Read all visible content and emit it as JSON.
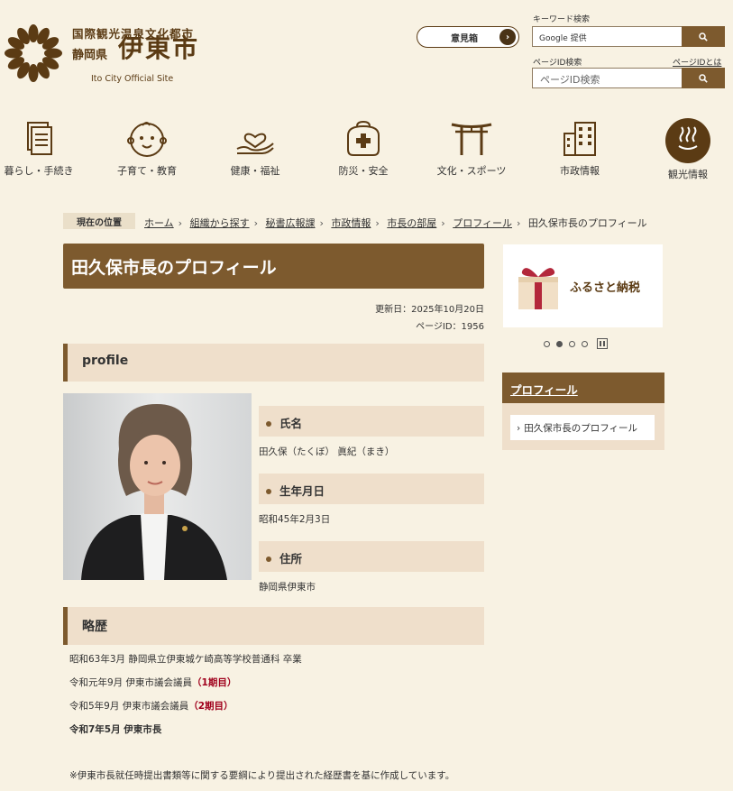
{
  "header": {
    "logo_line1": "国際観光温泉文化都市",
    "logo_prefecture": "静岡県",
    "logo_city": "伊東市",
    "logo_en": "Ito City Official Site",
    "voice_box_label": "意見箱",
    "keyword_label": "キーワード検索",
    "keyword_placeholder": "Google 提供",
    "pageid_label": "ページID検索",
    "pageid_help": "ページIDとは",
    "pageid_placeholder": "ページID検索"
  },
  "nav": [
    {
      "label": "暮らし・手続き",
      "icon": "document-icon"
    },
    {
      "label": "子育て・教育",
      "icon": "baby-face-icon"
    },
    {
      "label": "健康・福祉",
      "icon": "heart-hand-icon"
    },
    {
      "label": "防災・安全",
      "icon": "emergency-bag-icon"
    },
    {
      "label": "文化・スポーツ",
      "icon": "torii-icon"
    },
    {
      "label": "市政情報",
      "icon": "building-icon"
    },
    {
      "label": "観光情報",
      "icon": "hot-spring-icon"
    }
  ],
  "breadcrumb": {
    "here_label": "現在の位置",
    "items": [
      "ホーム",
      "組織から探す",
      "秘書広報課",
      "市政情報",
      "市長の部屋",
      "プロフィール"
    ],
    "current": "田久保市長のプロフィール"
  },
  "page": {
    "title": "田久保市長のプロフィール",
    "updated": "更新日：2025年10月20日",
    "page_id": "ページID：1956",
    "section_profile": "profile",
    "fields": [
      {
        "label": "氏名",
        "value": "田久保（たくぼ）  眞紀（まき）"
      },
      {
        "label": "生年月日",
        "value": "昭和45年2月3日"
      },
      {
        "label": "住所",
        "value": "静岡県伊東市"
      }
    ],
    "section_career": "略歴",
    "career": [
      {
        "text": "昭和63年3月 静岡県立伊東城ケ崎高等学校普通科 卒業",
        "note": ""
      },
      {
        "text": "令和元年9月 伊東市議会議員",
        "note": "（1期目）"
      },
      {
        "text": "令和5年9月 伊東市議会議員",
        "note": "（2期目）"
      },
      {
        "text": "令和7年5月 伊東市長",
        "note": ""
      }
    ],
    "footnote": "※伊東市長就任時提出書類等に関する要綱により提出された経歴書を基に作成しています。"
  },
  "sidebar": {
    "banner_text": "ふるさと納税",
    "carousel_total": 4,
    "carousel_active": 2,
    "menu_title": "プロフィール",
    "menu_items": [
      "田久保市長のプロフィール"
    ]
  }
}
